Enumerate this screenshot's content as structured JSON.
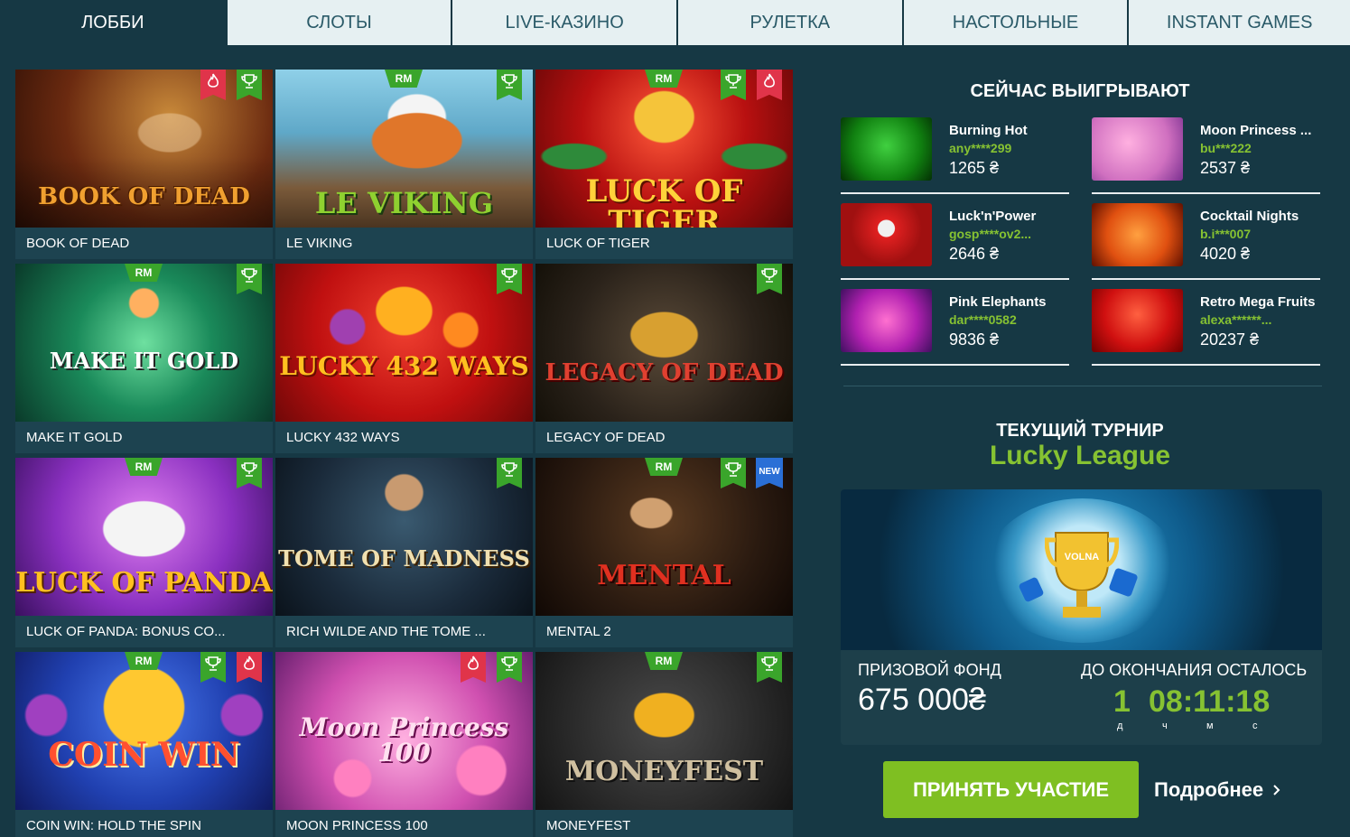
{
  "tabs": [
    {
      "label": "ЛОББИ",
      "active": true
    },
    {
      "label": "СЛОТЫ",
      "active": false
    },
    {
      "label": "LIVE-КАЗИНО",
      "active": false
    },
    {
      "label": "РУЛЕТКА",
      "active": false
    },
    {
      "label": "НАСТОЛЬНЫЕ",
      "active": false
    },
    {
      "label": "INSTANT GAMES",
      "active": false
    }
  ],
  "games": [
    {
      "title": "BOOK OF DEAD",
      "logo": "BOOK OF DEAD",
      "rm": false,
      "badges": [
        "fire-icon",
        "trophy-icon"
      ]
    },
    {
      "title": "LE VIKING",
      "logo": "LE VIKING",
      "rm": true,
      "badges": [
        "trophy-icon"
      ]
    },
    {
      "title": "LUCK OF TIGER",
      "logo": "LUCK OF TIGER",
      "rm": true,
      "badges": [
        "trophy-icon",
        "fire-icon"
      ]
    },
    {
      "title": "MAKE IT GOLD",
      "logo": "MAKE IT GOLD",
      "rm": true,
      "badges": [
        "trophy-icon"
      ]
    },
    {
      "title": "LUCKY 432 WAYS",
      "logo": "LUCKY 432 WAYS",
      "rm": false,
      "badges": [
        "trophy-icon"
      ]
    },
    {
      "title": "LEGACY OF DEAD",
      "logo": "LEGACY OF DEAD",
      "rm": false,
      "badges": [
        "trophy-icon"
      ]
    },
    {
      "title": "LUCK OF PANDA: BONUS CO...",
      "logo": "LUCK OF PANDA",
      "rm": true,
      "badges": [
        "trophy-icon"
      ]
    },
    {
      "title": "RICH WILDE AND THE TOME ...",
      "logo": "TOME OF MADNESS",
      "rm": false,
      "badges": [
        "trophy-icon"
      ]
    },
    {
      "title": "MENTAL 2",
      "logo": "MENTAL",
      "rm": true,
      "badges": [
        "trophy-icon",
        "new-icon"
      ]
    },
    {
      "title": "COIN WIN: HOLD THE SPIN",
      "logo": "COIN WIN",
      "rm": true,
      "badges": [
        "trophy-icon",
        "fire-icon"
      ]
    },
    {
      "title": "MOON PRINCESS 100",
      "logo": "Moon Princess 100",
      "rm": false,
      "badges": [
        "fire-icon",
        "trophy-icon"
      ]
    },
    {
      "title": "MONEYFEST",
      "logo": "MONEYFEST",
      "rm": true,
      "badges": [
        "trophy-icon"
      ]
    }
  ],
  "badge_labels": {
    "rm": "RM",
    "new": "NEW"
  },
  "winners_title": "СЕЙЧАС ВЫИГРЫВАЮТ",
  "winners": [
    {
      "game": "Burning Hot",
      "user": "any****299",
      "amount": "1265 ₴"
    },
    {
      "game": "Moon Princess ...",
      "user": "bu***222",
      "amount": "2537 ₴"
    },
    {
      "game": "Luck'n'Power",
      "user": "gosp****ov2...",
      "amount": "2646 ₴"
    },
    {
      "game": "Cocktail Nights",
      "user": "b.i***007",
      "amount": "4020 ₴"
    },
    {
      "game": "Pink Elephants",
      "user": "dar****0582",
      "amount": "9836 ₴"
    },
    {
      "game": "Retro Mega Fruits",
      "user": "alexa******...",
      "amount": "20237 ₴"
    }
  ],
  "tournament": {
    "label": "ТЕКУЩИЙ ТУРНИР",
    "name": "Lucky League",
    "banner_text": "VOLNA",
    "prize_label": "ПРИЗОВОЙ ФОНД",
    "prize_value": "675 000₴",
    "timer_label": "ДО ОКОНЧАНИЯ ОСТАЛОСЬ",
    "days": "1",
    "time": "08:11:18",
    "units": [
      "д",
      "ч",
      "м",
      "с"
    ],
    "join_label": "ПРИНЯТЬ УЧАСТИЕ",
    "more_label": "Подробнее"
  },
  "colors": {
    "background": "#163844",
    "accent_green": "#86c232",
    "button_green": "#7fbf22",
    "badge_green": "#3aa52b",
    "badge_red": "#e0344a",
    "tab_inactive": "#e6f0f2"
  }
}
